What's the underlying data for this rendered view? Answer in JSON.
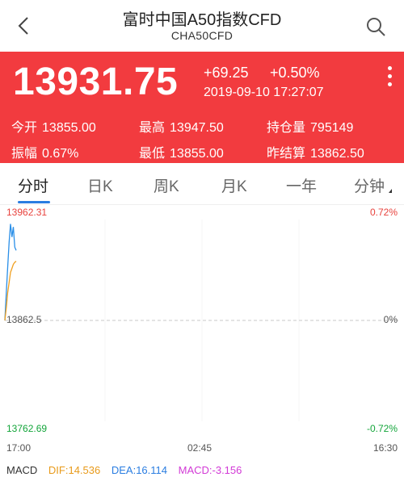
{
  "header": {
    "title": "富时中国A50指数CFD",
    "subtitle": "CHA50CFD"
  },
  "quote": {
    "price": "13931.75",
    "change": "+69.25",
    "change_pct": "+0.50%",
    "datetime": "2019-09-10 17:27:07",
    "stats": [
      {
        "label": "今开",
        "value": "13855.00"
      },
      {
        "label": "最高",
        "value": "13947.50"
      },
      {
        "label": "持仓量",
        "value": "795149"
      },
      {
        "label": "振幅",
        "value": "0.67%"
      },
      {
        "label": "最低",
        "value": "13855.00"
      },
      {
        "label": "昨结算",
        "value": "13862.50"
      }
    ]
  },
  "tabs": [
    {
      "label": "分时"
    },
    {
      "label": "日K"
    },
    {
      "label": "周K"
    },
    {
      "label": "月K"
    },
    {
      "label": "一年"
    },
    {
      "label": "分钟"
    }
  ],
  "chart_data": {
    "type": "line",
    "y_top": "13962.31",
    "y_mid": "13862.5",
    "y_bottom": "13762.69",
    "pct_top": "0.72%",
    "pct_mid": "0%",
    "pct_bottom": "-0.72%",
    "x_labels": [
      "17:00",
      "02:45",
      "16:30"
    ],
    "ylim": [
      13762.69,
      13962.31
    ],
    "baseline": 13862.5,
    "series": [
      {
        "values": [
          13862.5,
          13890,
          13915,
          13940,
          13958,
          13945,
          13955,
          13935,
          13931.75
        ],
        "color": "#2a8fe8"
      },
      {
        "values": [
          13862.5,
          13875,
          13890,
          13900,
          13910,
          13914,
          13918,
          13920,
          13921
        ],
        "color": "#f0a020"
      }
    ]
  },
  "macd": {
    "label": "MACD",
    "dif": "DIF:14.536",
    "dea": "DEA:16.114",
    "macd": "MACD:-3.156"
  },
  "colors": {
    "up": "#f23b3f",
    "accent": "#2a7de1",
    "down": "#13a53a"
  }
}
